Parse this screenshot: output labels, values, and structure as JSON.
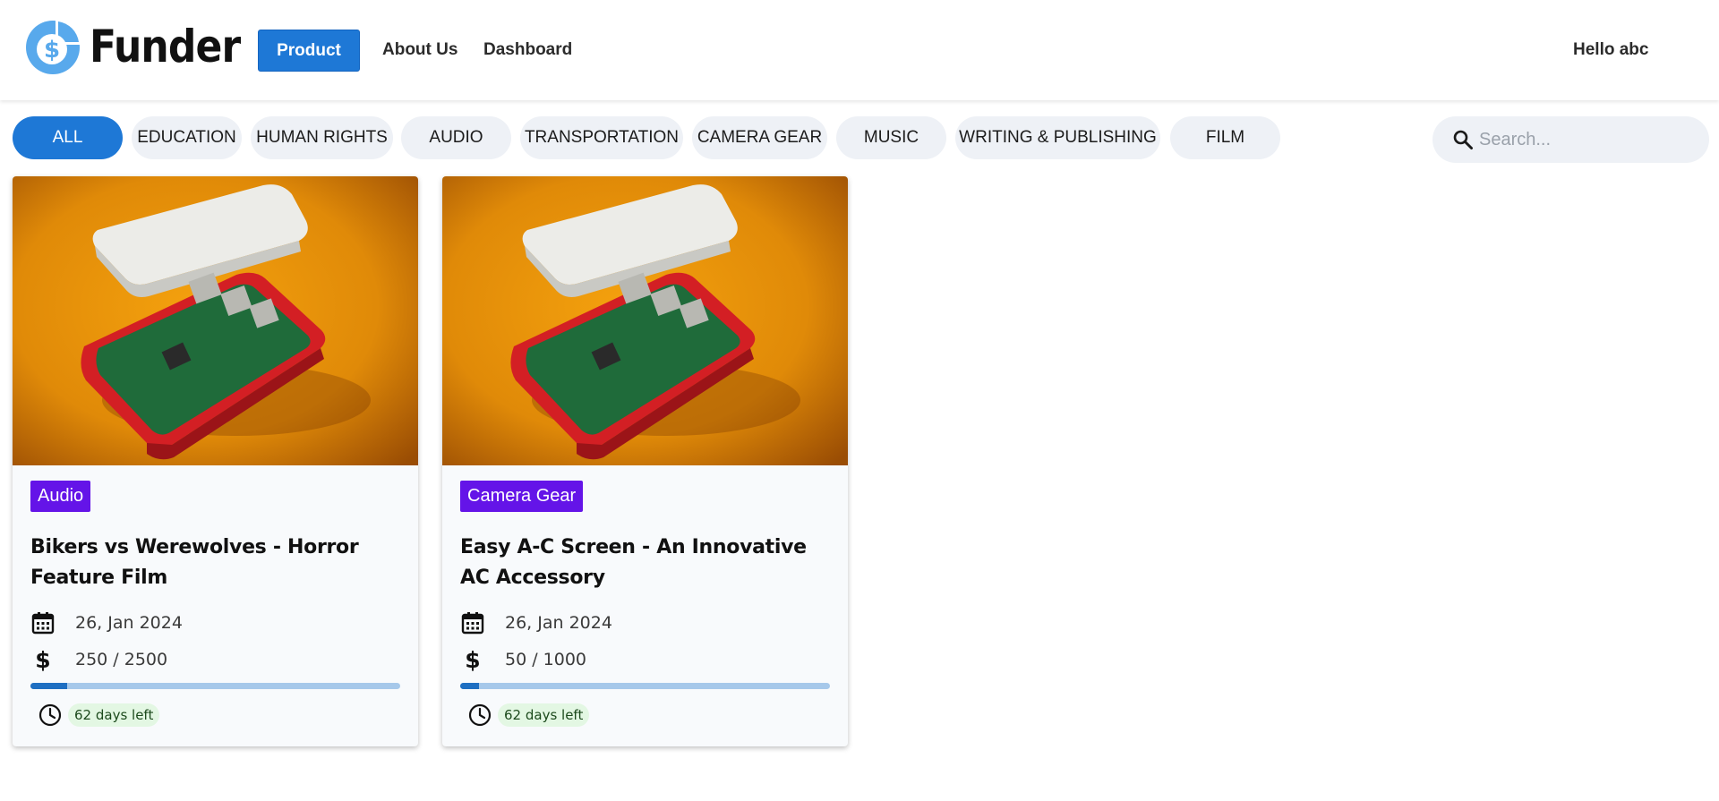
{
  "header": {
    "brand": "Funder",
    "nav": {
      "product": "Product",
      "about": "About Us",
      "dashboard": "Dashboard"
    },
    "greeting": "Hello abc"
  },
  "filters": {
    "items": [
      "ALL",
      "EDUCATION",
      "HUMAN RIGHTS",
      "AUDIO",
      "TRANSPORTATION",
      "CAMERA GEAR",
      "MUSIC",
      "WRITING & PUBLISHING",
      "FILM"
    ],
    "active": "ALL"
  },
  "search": {
    "placeholder": "Search..."
  },
  "cards": [
    {
      "category": "Audio",
      "title": "Bikers vs Werewolves - Horror Feature Film",
      "date": "26, Jan 2024",
      "funding": "250 / 2500",
      "progress": 0.1,
      "days_left": "62 days left"
    },
    {
      "category": "Camera Gear",
      "title": "Easy A-C Screen - An Innovative AC Accessory",
      "date": "26, Jan 2024",
      "funding": "50 / 1000",
      "progress": 0.05,
      "days_left": "62 days left"
    }
  ],
  "colors": {
    "primary": "#1e78d6",
    "badge": "#6414e8",
    "chip": "#eef1f6",
    "days_pill": "#e3f7e3"
  },
  "icons": [
    "funder-logo-icon",
    "search-icon",
    "calendar-icon",
    "dollar-icon",
    "clock-icon"
  ]
}
